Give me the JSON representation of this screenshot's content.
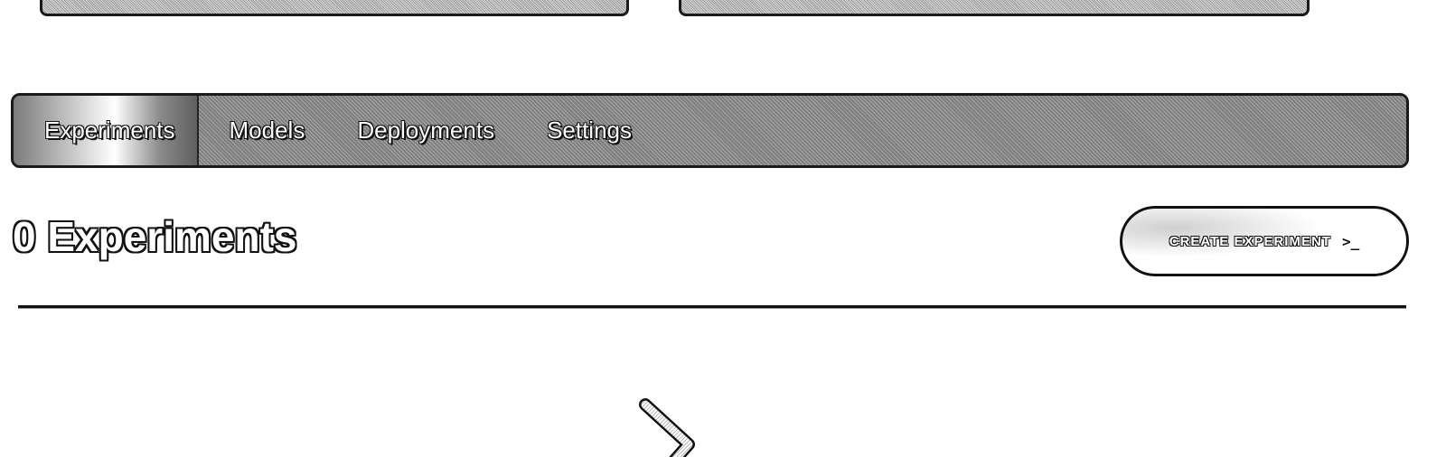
{
  "nav": {
    "tabs": [
      {
        "label": "Experiments",
        "active": true
      },
      {
        "label": "Models",
        "active": false
      },
      {
        "label": "Deployments",
        "active": false
      },
      {
        "label": "Settings",
        "active": false
      }
    ]
  },
  "header": {
    "title": "0 Experiments",
    "create_button_label": "CREATE EXPERIMENT",
    "create_button_icon": "terminal-icon"
  },
  "empty_state": {
    "icon": "chevron-right-icon"
  }
}
